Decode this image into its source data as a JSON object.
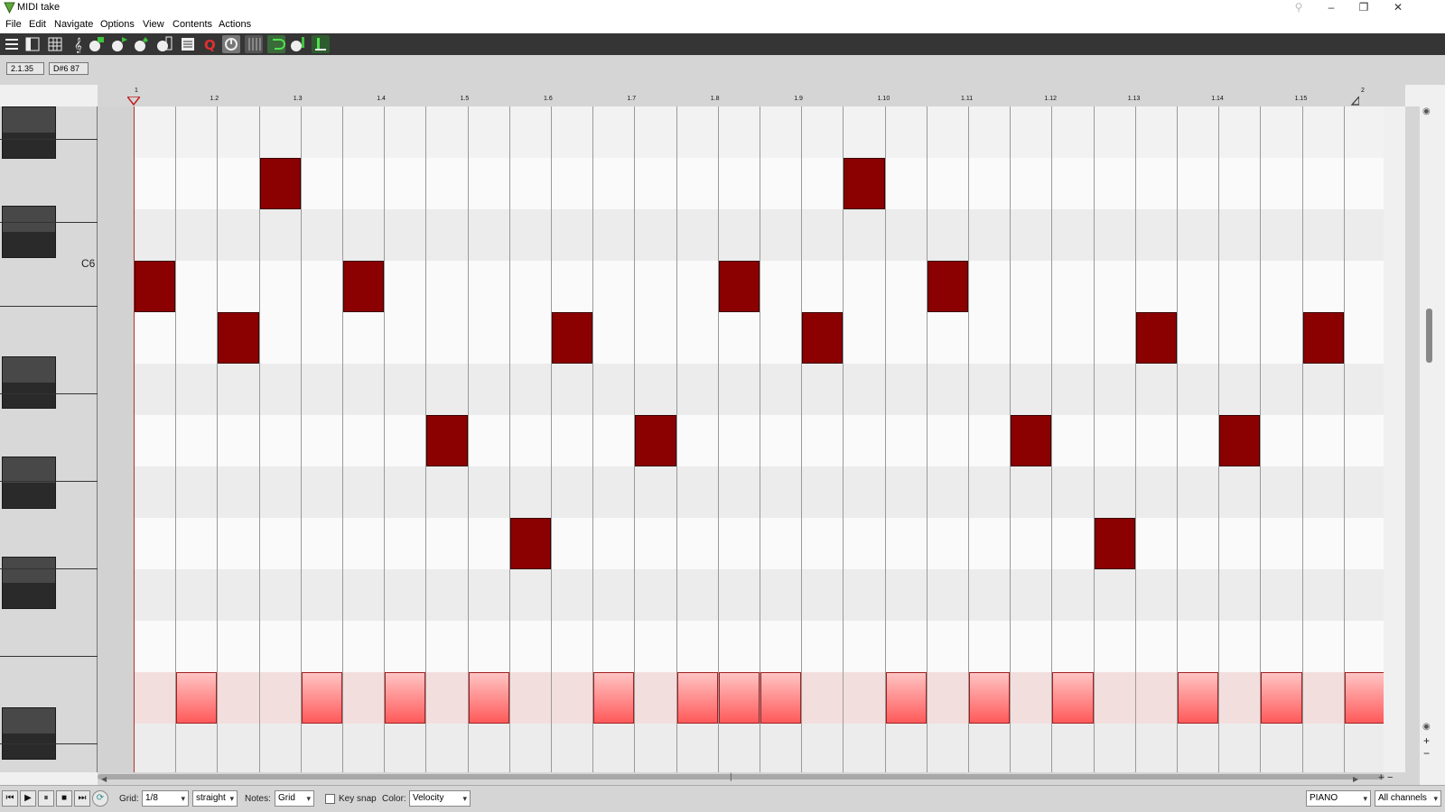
{
  "window": {
    "title": "MIDI take",
    "minimize": "–",
    "restore": "❐",
    "close": "✕"
  },
  "menu": [
    "File",
    "Edit",
    "Navigate",
    "Options",
    "View",
    "Contents",
    "Actions"
  ],
  "info": {
    "position": "2.1.35",
    "note": "D#6  87"
  },
  "ruler": {
    "start_label": "1",
    "end_label": "2",
    "beat_labels": [
      "1.2",
      "1.3",
      "1.4",
      "1.5",
      "1.6",
      "1.7",
      "1.8",
      "1.9",
      "1.10",
      "1.11",
      "1.12",
      "1.13",
      "1.14",
      "1.15"
    ]
  },
  "keyboard": {
    "c_label": "C6"
  },
  "notes": [
    {
      "row": 3,
      "col": 0
    },
    {
      "row": 4,
      "col": 2
    },
    {
      "row": 1,
      "col": 3
    },
    {
      "row": 3,
      "col": 5
    },
    {
      "row": 6,
      "col": 7
    },
    {
      "row": 8,
      "col": 9
    },
    {
      "row": 4,
      "col": 10
    },
    {
      "row": 6,
      "col": 12
    },
    {
      "row": 3,
      "col": 14
    },
    {
      "row": 4,
      "col": 16
    },
    {
      "row": 1,
      "col": 17
    },
    {
      "row": 3,
      "col": 19
    },
    {
      "row": 6,
      "col": 21
    },
    {
      "row": 8,
      "col": 23
    },
    {
      "row": 4,
      "col": 24
    },
    {
      "row": 6,
      "col": 26
    },
    {
      "row": 4,
      "col": 28
    }
  ],
  "selected_notes": {
    "row": 11,
    "cols": [
      1,
      4,
      6,
      8,
      11,
      13,
      14,
      15,
      18,
      20,
      22,
      25,
      27,
      29
    ]
  },
  "bottombar": {
    "grid_label": "Grid:",
    "grid_value": "1/8",
    "grid_type": "straight",
    "notes_label": "Notes:",
    "notes_value": "Grid",
    "keysnap_label": "Key snap",
    "color_label": "Color:",
    "color_value": "Velocity",
    "key_mode": "PIANO",
    "channels": "All channels"
  },
  "transport": [
    "⏮",
    "▶",
    "⏸",
    "■",
    "⏭",
    "⟳"
  ],
  "colors": {
    "note": "#8b0000",
    "selected_note": "#ff6a6a",
    "toolbar": "#353535"
  }
}
